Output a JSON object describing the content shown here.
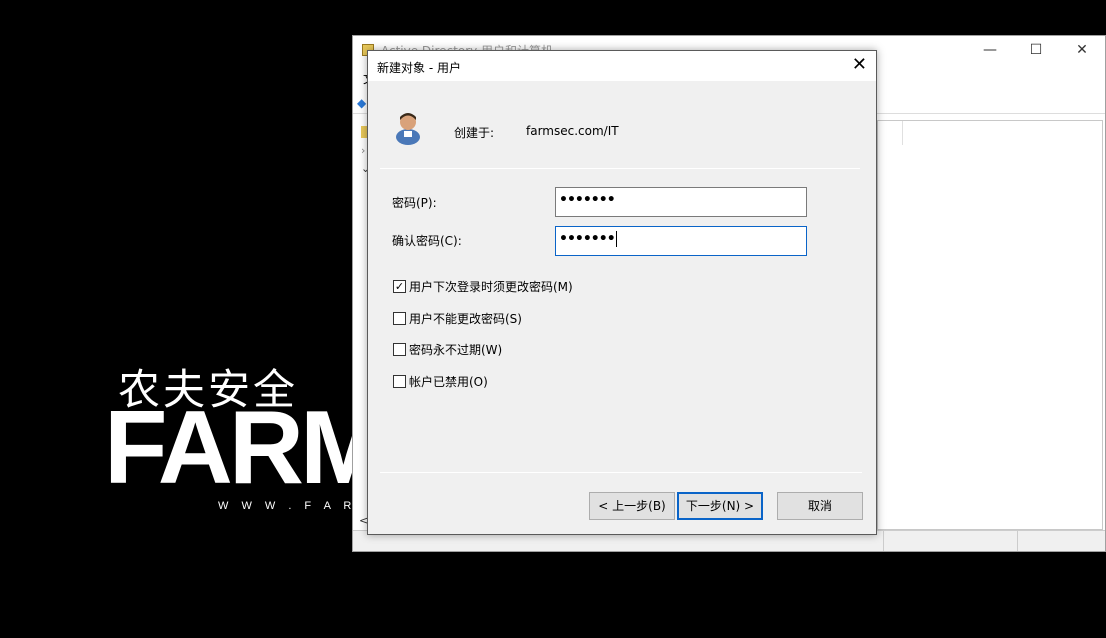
{
  "wallpaper": {
    "brand_cn": "农夫安全",
    "brand_en": "FARM",
    "url": "W W W . F A R M S E"
  },
  "background_window": {
    "title": "Active Directory 用户和计算机",
    "menu_first_letter": "文",
    "controls": {
      "minimize": "—",
      "maximize": "☐",
      "close": "✕"
    },
    "tree_arrow_collapsed": "›",
    "tree_arrow_expanded": "⌄",
    "scroll_left": "<"
  },
  "dialog": {
    "title": "新建对象 - 用户",
    "close_glyph": "✕",
    "created_in_label": "创建于:",
    "created_in_value": "farmsec.com/IT",
    "password_label": "密码(P):",
    "password_value": "•••••••",
    "confirm_password_label": "确认密码(C):",
    "confirm_password_value": "•••••••",
    "options": [
      {
        "label": "用户下次登录时须更改密码(M)",
        "checked": true
      },
      {
        "label": "用户不能更改密码(S)",
        "checked": false
      },
      {
        "label": "密码永不过期(W)",
        "checked": false
      },
      {
        "label": "帐户已禁用(O)",
        "checked": false
      }
    ],
    "checkmark_glyph": "✓",
    "buttons": {
      "back": "< 上一步(B)",
      "next": "下一步(N) >",
      "cancel": "取消"
    }
  }
}
